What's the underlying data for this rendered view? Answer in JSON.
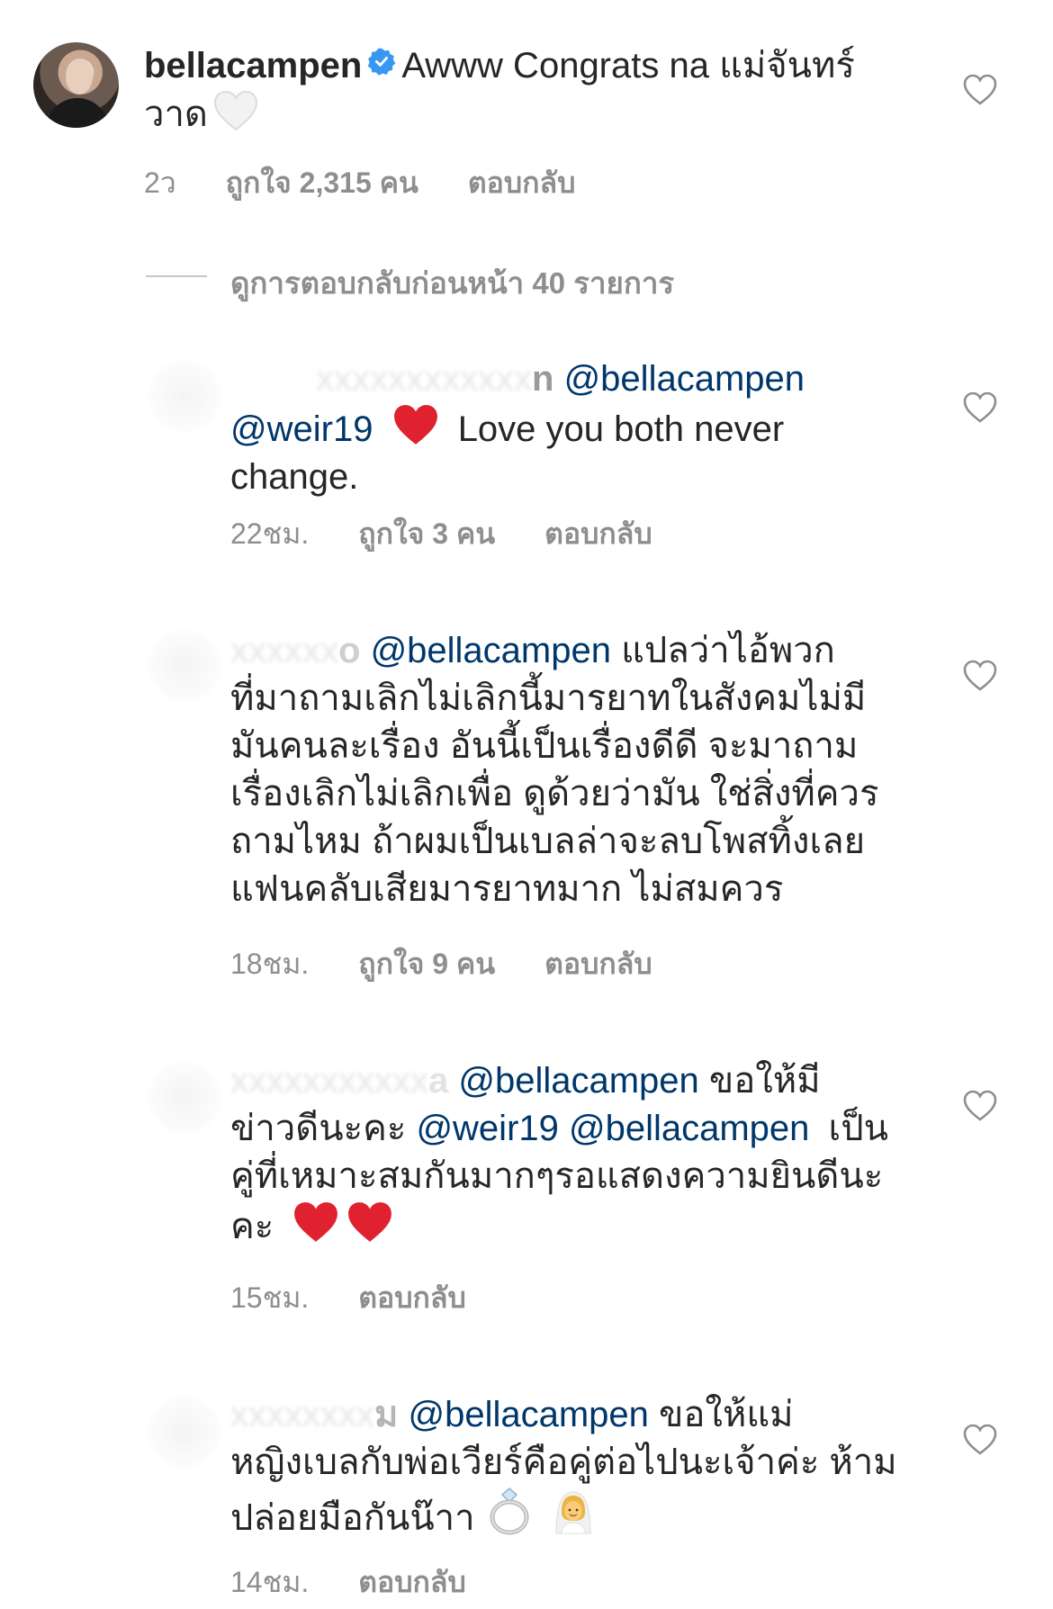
{
  "top_comment": {
    "username": "bellacampen",
    "text": "Awww Congrats na แม่จันทร์วาด",
    "time": "2ว",
    "likes": "ถูกใจ 2,315 คน",
    "reply": "ตอบกลับ"
  },
  "view_replies": "ดูการตอบกลับก่อนหน้า 40 รายการ",
  "replies": [
    {
      "username_fragment": "n",
      "mention1": "@bellacampen",
      "mention2": "@weir19",
      "text": "Love you both never change.",
      "time": "22ชม.",
      "likes": "ถูกใจ 3 คน",
      "reply": "ตอบกลับ"
    },
    {
      "username_fragment": "o",
      "mention1": "@bellacampen",
      "text1": "แปลว่าไอ้พวก",
      "text2": "ที่มาถามเลิกไม่เลิกนี้มารยาทในสังคมไม่มี",
      "text3": "มันคนละเรื่อง อันนี้เป็นเรื่องดีดี จะมาถาม",
      "text4": "เรื่องเลิกไม่เลิกเพื่อ ดูด้วยว่ามัน ใช่สิ่งที่ควร",
      "text5": "ถามไหม ถ้าผมเป็นเบลล่าจะลบโพสทิ้งเลย",
      "text6": "แฟนคลับเสียมารยาทมาก ไม่สมควร",
      "time": "18ชม.",
      "likes": "ถูกใจ 9 คน",
      "reply": "ตอบกลับ"
    },
    {
      "username_fragment": "a",
      "mention1": "@bellacampen",
      "text1": "ขอให้มี",
      "text2a": "ข่าวดีนะคะ",
      "mention2": "@weir19",
      "mention3": "@bellacampen",
      "text2b": "เป็น",
      "text3": "คู่ที่เหมาะสมกันมากๆรอแสดงความยินดีนะ",
      "text4": "คะ",
      "time": "15ชม.",
      "reply": "ตอบกลับ"
    },
    {
      "username_fragment": "ม",
      "mention1": "@bellacampen",
      "text1": "ขอให้แม่",
      "text2": "หญิงเบลกับพ่อเวียร์คือคู่ต่อไปนะเจ้าค่ะ ห้าม",
      "text3": "ปล่อยมือกันน๊าา",
      "time": "14ชม.",
      "reply": "ตอบกลับ"
    }
  ],
  "colors": {
    "mention": "#00376b",
    "meta": "#8e8e8e",
    "text": "#262626",
    "heart_red": "#e0212f",
    "verified": "#3897f0"
  }
}
